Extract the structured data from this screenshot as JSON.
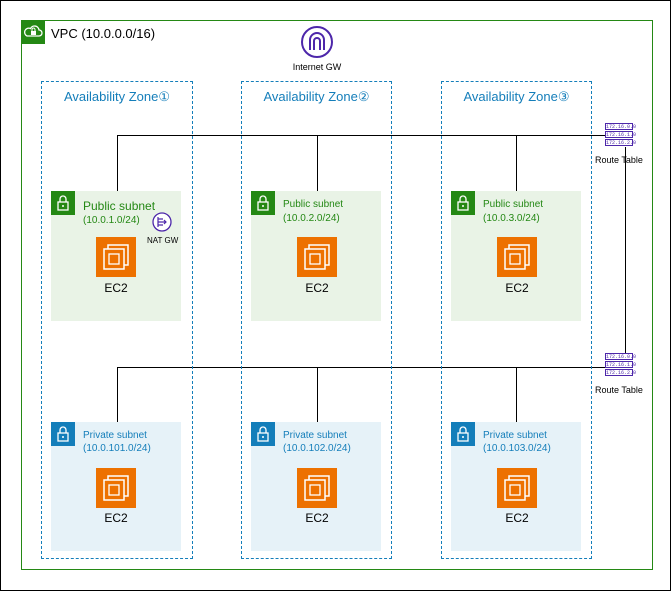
{
  "vpc": {
    "label": "VPC (10.0.0.0/16)"
  },
  "internet_gw": {
    "label": "Internet GW"
  },
  "nat_gw": {
    "label": "NAT GW"
  },
  "route_tables": [
    {
      "label": "Route Table",
      "rows": [
        "172.16.0.0",
        "172.16.1.0",
        "172.16.2.0"
      ]
    },
    {
      "label": "Route Table",
      "rows": [
        "172.16.0.0",
        "172.16.1.0",
        "172.16.2.0"
      ]
    }
  ],
  "zones": [
    {
      "label": "Availability Zone①",
      "public": {
        "name": "Public subnet",
        "cidr": "(10.0.1.0/24)",
        "ec2": "EC2"
      },
      "private": {
        "name": "Private subnet",
        "cidr": "(10.0.101.0/24)",
        "ec2": "EC2"
      }
    },
    {
      "label": "Availability Zone②",
      "public": {
        "name": "Public subnet",
        "cidr": "(10.0.2.0/24)",
        "ec2": "EC2"
      },
      "private": {
        "name": "Private subnet",
        "cidr": "(10.0.102.0/24)",
        "ec2": "EC2"
      }
    },
    {
      "label": "Availability Zone③",
      "public": {
        "name": "Public subnet",
        "cidr": "(10.0.3.0/24)",
        "ec2": "EC2"
      },
      "private": {
        "name": "Private subnet",
        "cidr": "(10.0.103.0/24)",
        "ec2": "EC2"
      }
    }
  ],
  "colors": {
    "vpc_border": "#248814",
    "az_border": "#147eba",
    "public_fill": "#e9f3e6",
    "private_fill": "#e6f2f8",
    "ec2_orange": "#ed7100",
    "igw_purple": "#4d27aa"
  },
  "icons": {
    "vpc": "cloud-lock-icon",
    "internet_gw": "internet-gateway-icon",
    "nat_gw": "nat-gateway-icon",
    "lock": "lock-icon",
    "ec2": "ec2-instance-icon",
    "route_table": "route-table-icon"
  }
}
